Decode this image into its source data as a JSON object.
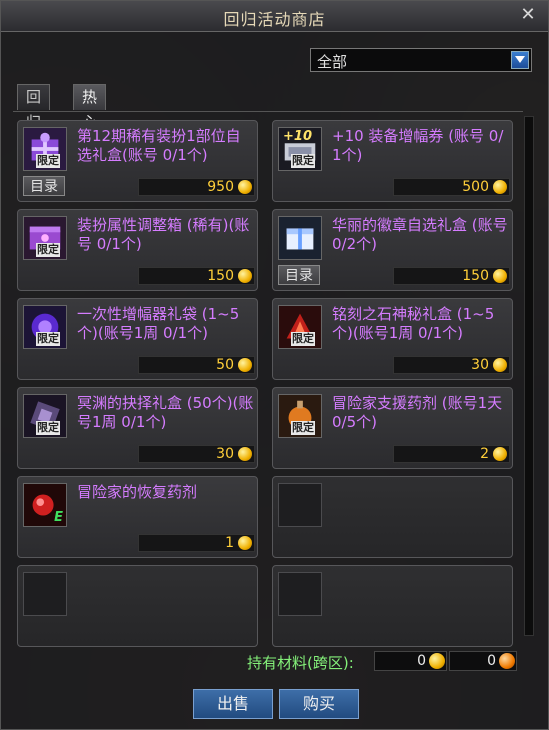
{
  "window": {
    "title": "回归活动商店",
    "close_glyph": "✕"
  },
  "filter": {
    "selected": "全部"
  },
  "tabs": [
    {
      "label": "回归",
      "active": false
    },
    {
      "label": "热心",
      "active": true
    }
  ],
  "items": [
    {
      "name": "第12期稀有装扮1部位自选礼盒(账号 0/1个)",
      "price": "950",
      "limited": "限定",
      "catalog": "目录",
      "icon": "purple-gift-box-icon"
    },
    {
      "name": "+10 装备增幅券 (账号 0/1个)",
      "price": "500",
      "limited": "限定",
      "catalog": "",
      "icon": "amplify-ticket-icon",
      "icon_text": "+10"
    },
    {
      "name": "装扮属性调整箱 (稀有)(账号 0/1个)",
      "price": "150",
      "limited": "限定",
      "catalog": "",
      "icon": "avatar-box-icon"
    },
    {
      "name": "华丽的徽章自选礼盒 (账号 0/2个)",
      "price": "150",
      "limited": "",
      "catalog": "目录",
      "icon": "emblem-box-icon"
    },
    {
      "name": "一次性增幅器礼袋 (1~5个)(账号1周 0/1个)",
      "price": "50",
      "limited": "限定",
      "catalog": "",
      "icon": "amplifier-bag-icon"
    },
    {
      "name": "铭刻之石神秘礼盒 (1~5个)(账号1周 0/1个)",
      "price": "30",
      "limited": "限定",
      "catalog": "",
      "icon": "inscription-stone-icon"
    },
    {
      "name": "冥渊的抉择礼盒 (50个)(账号1周 0/1个)",
      "price": "30",
      "limited": "限定",
      "catalog": "",
      "icon": "abyss-box-icon"
    },
    {
      "name": "冒险家支援药剂 (账号1天 0/5个)",
      "price": "2",
      "limited": "限定",
      "catalog": "",
      "icon": "support-potion-icon"
    },
    {
      "name": "冒险家的恢复药剂",
      "price": "1",
      "limited": "",
      "catalog": "",
      "icon": "recovery-potion-icon",
      "icon_text": "E"
    }
  ],
  "footer": {
    "materials_label": "持有材料(跨区):",
    "material1": "0",
    "material2": "0",
    "sell_label": "出售",
    "buy_label": "购买"
  },
  "colors": {
    "item_name": "#d57cff",
    "price": "#ffcf3a",
    "materials_label": "#84f17a"
  }
}
